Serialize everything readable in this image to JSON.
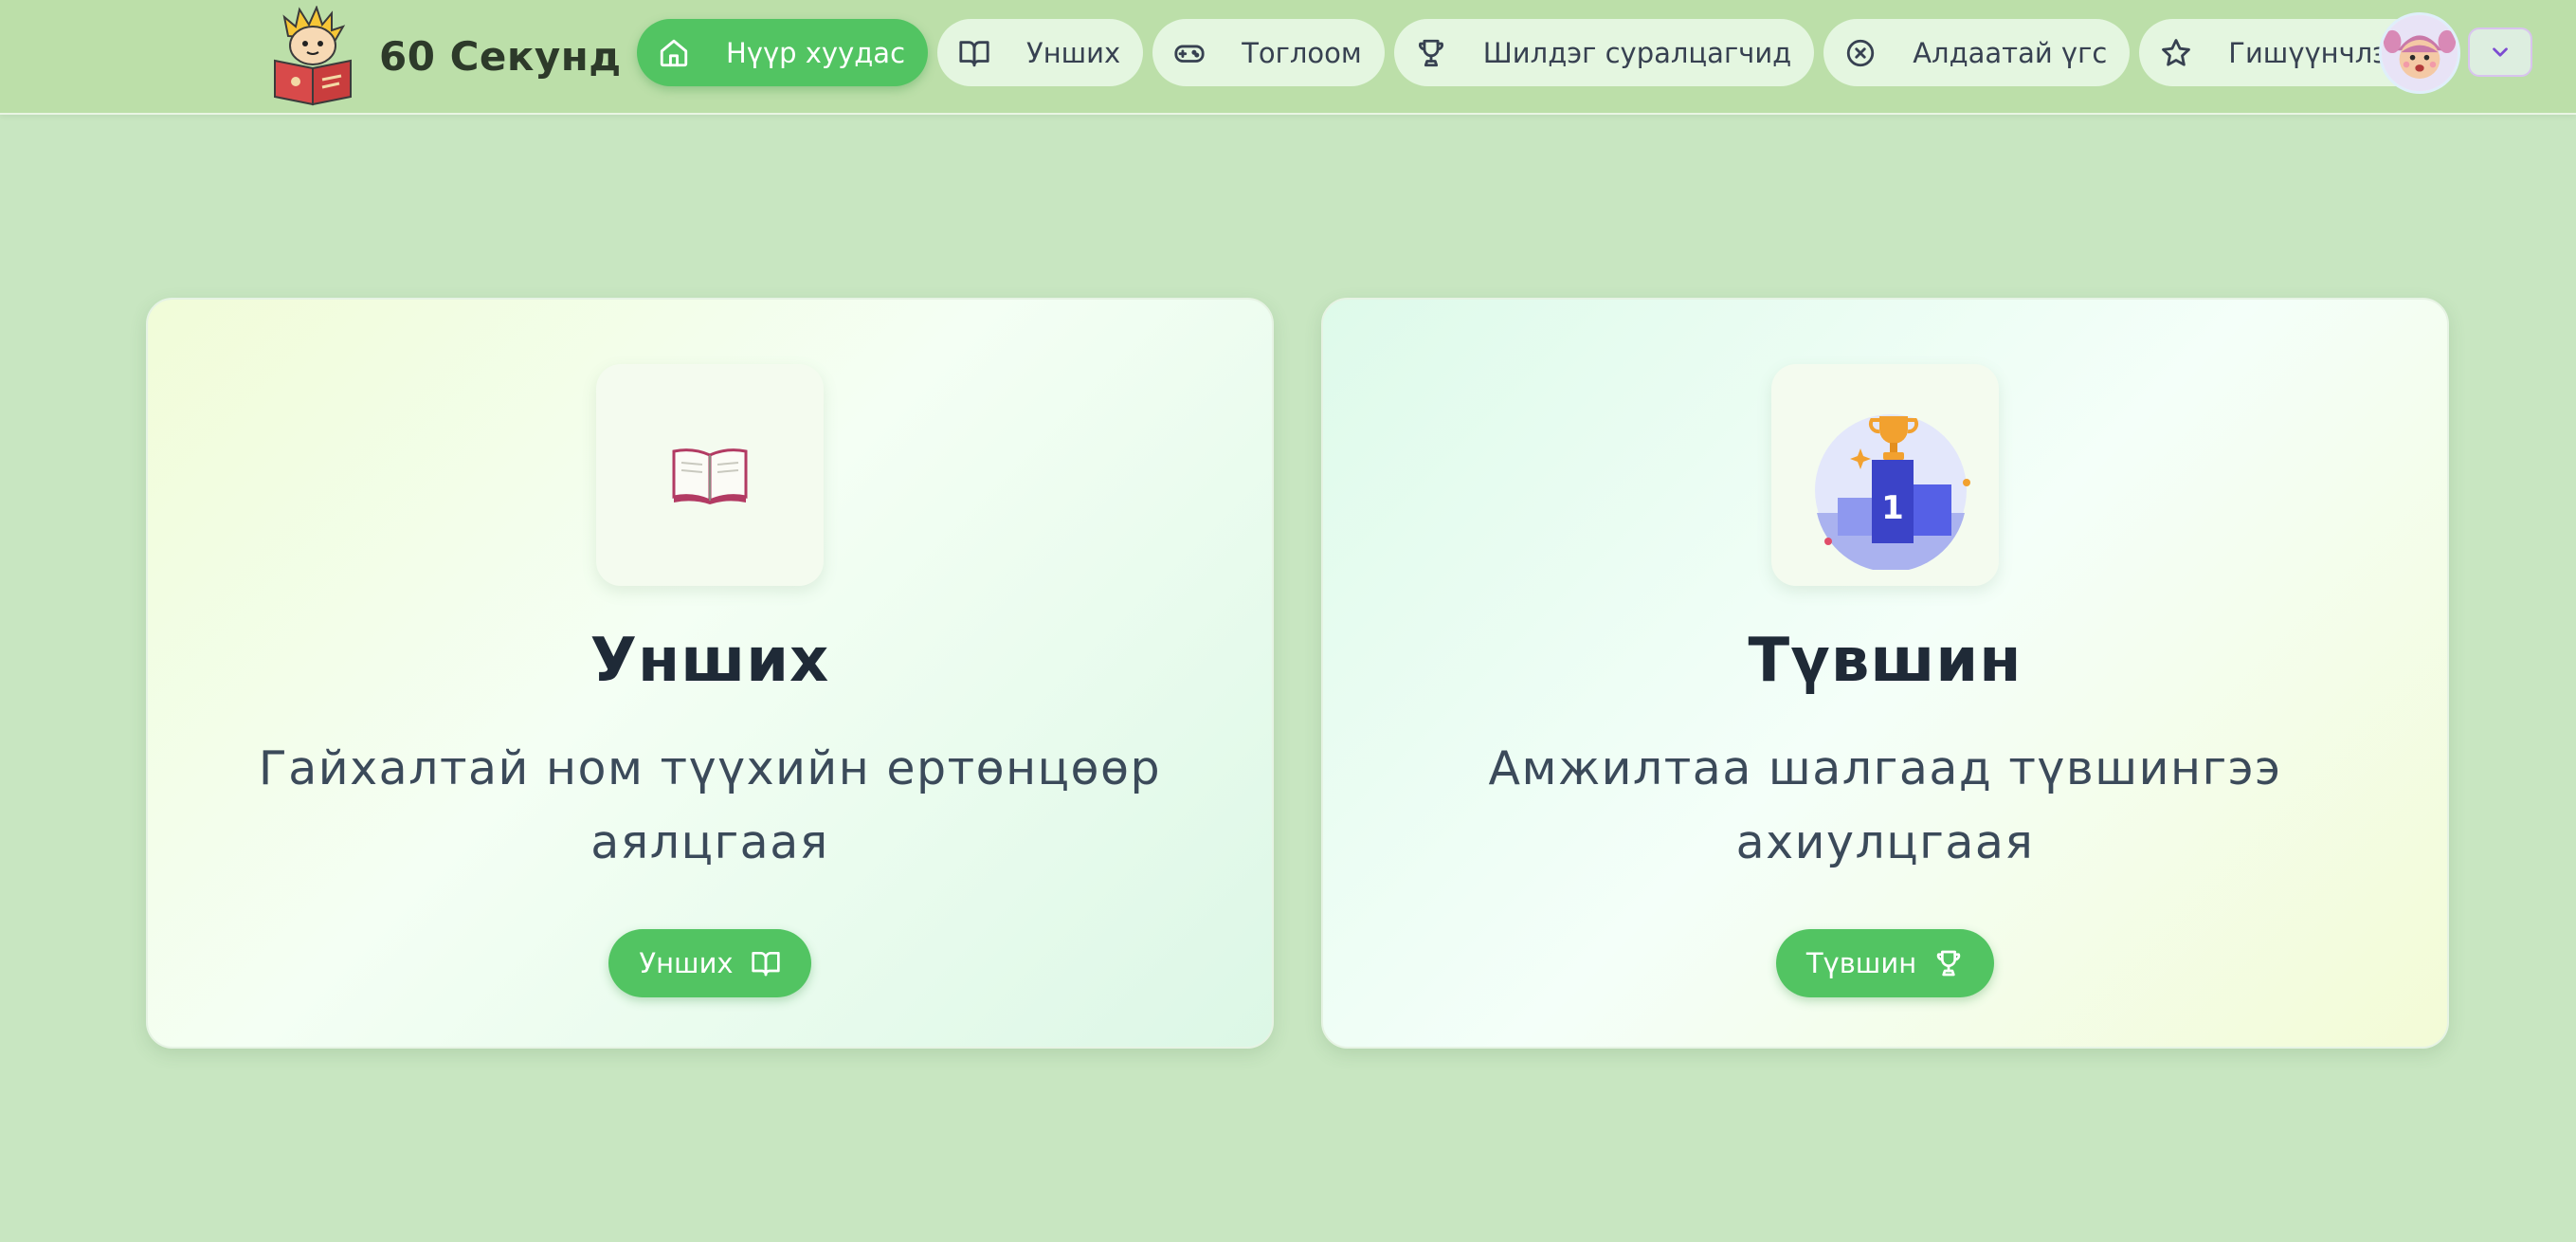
{
  "brand": {
    "name": "60 Секунд",
    "logo_icon": "reading-kid-logo"
  },
  "nav": {
    "items": [
      {
        "label": "Нүүр хуудас",
        "icon": "home-icon",
        "active": true
      },
      {
        "label": "Унших",
        "icon": "book-icon"
      },
      {
        "label": "Тоглоом",
        "icon": "gamepad-icon"
      },
      {
        "label": "Шилдэг суралцагчид",
        "icon": "trophy-icon"
      },
      {
        "label": "Алдаатай үгс",
        "icon": "x-circle-icon"
      },
      {
        "label": "Гишүүнчлэл",
        "icon": "star-icon"
      }
    ]
  },
  "user": {
    "avatar_icon": "girl-avatar",
    "menu_icon": "chevron-down-icon"
  },
  "cards": [
    {
      "title": "Унших",
      "description": "Гайхалтай ном түүхийн ертөнцөөр аялцгаая",
      "button_label": "Унших",
      "illustration": "open-book-emoji",
      "button_icon": "book-icon"
    },
    {
      "title": "Түвшин",
      "description": "Амжилтаа шалгаад түвшингээ ахиулцгаая",
      "button_label": "Түвшин",
      "illustration": "podium-trophy-illustration",
      "button_icon": "trophy-icon"
    }
  ],
  "colors": {
    "accent_green": "#52c462",
    "page_background": "#c8e6c1",
    "header_background": "#bcdfa9",
    "nav_pill": "#e4f6e0",
    "podium_blue": "#4b55e0",
    "trophy_gold": "#f2a12f"
  }
}
